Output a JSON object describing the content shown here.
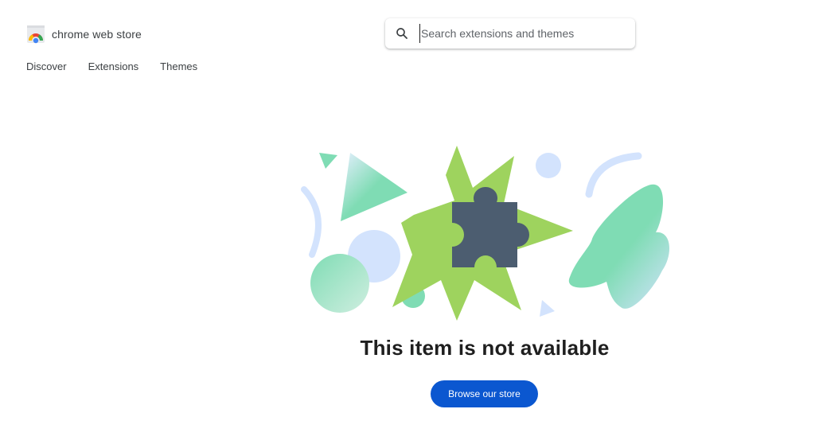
{
  "header": {
    "logo_text": "chrome web store",
    "search": {
      "placeholder": "Search extensions and themes",
      "value": ""
    }
  },
  "nav": {
    "items": [
      {
        "label": "Discover"
      },
      {
        "label": "Extensions"
      },
      {
        "label": "Themes"
      }
    ]
  },
  "main": {
    "title": "This item is not available",
    "browse_button_label": "Browse our store"
  },
  "icons": {
    "logo": "chrome-web-store-logo",
    "search": "search-icon",
    "illustration": "puzzle-piece-icon"
  },
  "colors": {
    "primary_button": "#0b57d0",
    "burst_green": "#9ed35e",
    "puzzle_slate": "#4c5d70",
    "mint": "#7fdcb4",
    "light_blue": "#d3e3fd"
  }
}
